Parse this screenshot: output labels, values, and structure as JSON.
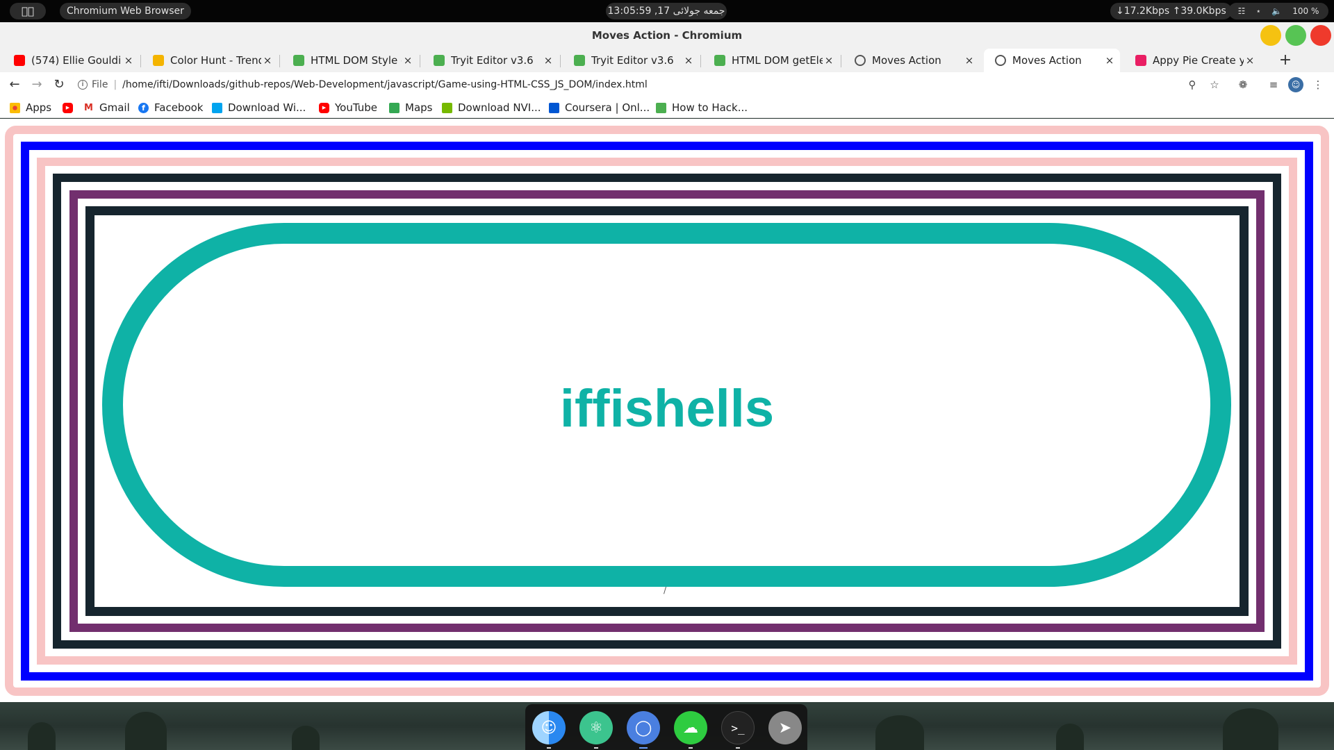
{
  "system_bar": {
    "app_name": "Chromium Web Browser",
    "clock": "13:05:59 ,17 جمعه جولائی",
    "network": "↓17.2Kbps ↑39.0Kbps",
    "battery": "100 %"
  },
  "window": {
    "title": "Moves Action - Chromium"
  },
  "tabs": [
    {
      "label": "(574) Ellie Gouldi",
      "icon": "youtube-icon",
      "icon_color": "#ff0000"
    },
    {
      "label": "Color Hunt - Trendy c",
      "icon": "color-hunt-icon",
      "icon_color": "#f4b400"
    },
    {
      "label": "HTML DOM Style co",
      "icon": "w3schools-icon",
      "icon_color": "#4caf50"
    },
    {
      "label": "Tryit Editor v3.6",
      "icon": "w3schools-icon",
      "icon_color": "#4caf50"
    },
    {
      "label": "Tryit Editor v3.6",
      "icon": "w3schools-icon",
      "icon_color": "#4caf50"
    },
    {
      "label": "HTML DOM getElem",
      "icon": "w3schools-icon",
      "icon_color": "#4caf50"
    },
    {
      "label": "Moves Action",
      "icon": "globe-icon",
      "icon_color": "#555555"
    },
    {
      "label": "Moves Action",
      "icon": "globe-icon",
      "icon_color": "#555555",
      "active": true
    },
    {
      "label": "Appy Pie Create you",
      "icon": "appypie-icon",
      "icon_color": "#e91e63"
    }
  ],
  "address_bar": {
    "protocol_label": "File",
    "url": "/home/ifti/Downloads/github-repos/Web-Development/javascript/Game-using-HTML-CSS_JS_DOM/index.html"
  },
  "bookmarks": [
    {
      "label": "Apps",
      "icon": "apps-grid-icon"
    },
    {
      "label": "",
      "icon": "youtube-icon"
    },
    {
      "label": "Gmail",
      "icon": "gmail-icon"
    },
    {
      "label": "Facebook",
      "icon": "facebook-icon"
    },
    {
      "label": "Download Wi...",
      "icon": "windows-icon"
    },
    {
      "label": "YouTube",
      "icon": "youtube-icon"
    },
    {
      "label": "Maps",
      "icon": "maps-icon"
    },
    {
      "label": "Download NVI...",
      "icon": "nvidia-icon"
    },
    {
      "label": "Coursera | Onl...",
      "icon": "coursera-icon"
    },
    {
      "label": "How to Hack...",
      "icon": "hack-icon"
    }
  ],
  "page": {
    "logo_text": "iffishells",
    "stray_text": "/",
    "colors": {
      "pink": "#f8c4c4",
      "blue": "#0000ff",
      "dark": "#16252e",
      "purple": "#722f6e",
      "teal": "#0fb2a6"
    }
  },
  "dock": {
    "apps": [
      "finder-icon",
      "atom-icon",
      "chromium-icon",
      "cloud-icon",
      "terminal-icon",
      "launchpad-icon"
    ]
  }
}
